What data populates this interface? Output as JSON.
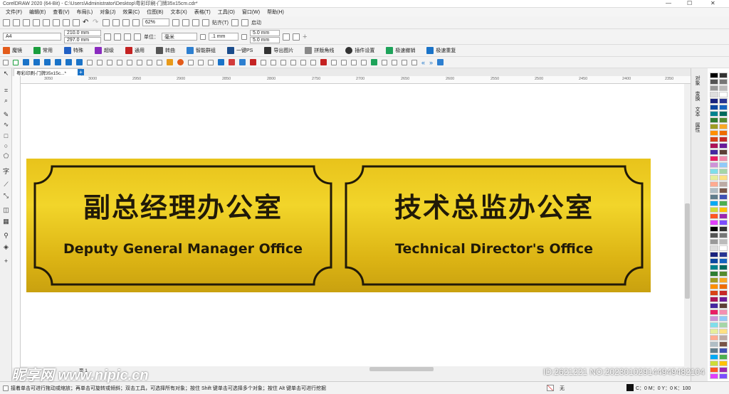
{
  "window": {
    "title": "CorelDRAW 2020 (64-Bit) - C:\\Users\\Administrator\\Desktop\\粤彩印刷-门牌35x15cm.cdr*"
  },
  "menu": [
    "文件(F)",
    "编辑(E)",
    "查看(V)",
    "布局(L)",
    "对象(J)",
    "效果(C)",
    "位图(B)",
    "文本(X)",
    "表格(T)",
    "工具(O)",
    "窗口(W)",
    "帮助(H)"
  ],
  "toolbar": {
    "zoom": "62%",
    "snap_label": "贴齐(T)",
    "launch_label": "启动"
  },
  "property_bar": {
    "paper": "A4",
    "width": "210.0 mm",
    "height": "297.0 mm",
    "unit_label": "单位：",
    "unit": "毫米",
    "nudge": ".1 mm",
    "dup_x": "5.0 mm",
    "dup_y": "5.0 mm"
  },
  "plugin_bar": [
    "魔镜",
    "常用",
    "特殊",
    "超级",
    "通用",
    "转曲",
    "智能群组",
    "一键PS",
    "导出图片",
    "拼版角线",
    "插件设置",
    "极速撤销",
    "极速重复"
  ],
  "document_tab": "粤彩印刷-门牌35x15c...*",
  "ruler_top": [
    "3050",
    "3000",
    "2950",
    "2900",
    "2850",
    "2800",
    "2750",
    "2700",
    "2650",
    "2600",
    "2550",
    "2500",
    "2450",
    "2400",
    "2350"
  ],
  "dock_tabs": [
    "对象",
    "变换",
    "文本",
    "属性"
  ],
  "signs": [
    {
      "chinese": "副总经理办公室",
      "english": "Deputy General Manager Office"
    },
    {
      "chinese": "技术总监办公室",
      "english": "Technical Director's Office"
    }
  ],
  "page_nav": {
    "page_label": "页 1"
  },
  "status": {
    "hint": "接着单击可进行拖动或缩放；再单击可旋转或倾斜；双击工具，可选择所有对象；按住 Shift 键单击可选择多个对象；按住 Alt 键单击可进行挖掘",
    "fill_none": "无",
    "color_readout": "C：0 M：0 Y：0 K：100"
  },
  "overlay": {
    "watermark": "昵享网 www.nipic.cn",
    "id_text": "ID:2621221 NO:20230102914494948210​4"
  },
  "colors": {
    "accent": "#1a73c8",
    "sign_gold": "#e8c31b",
    "sign_text": "#211a08"
  }
}
